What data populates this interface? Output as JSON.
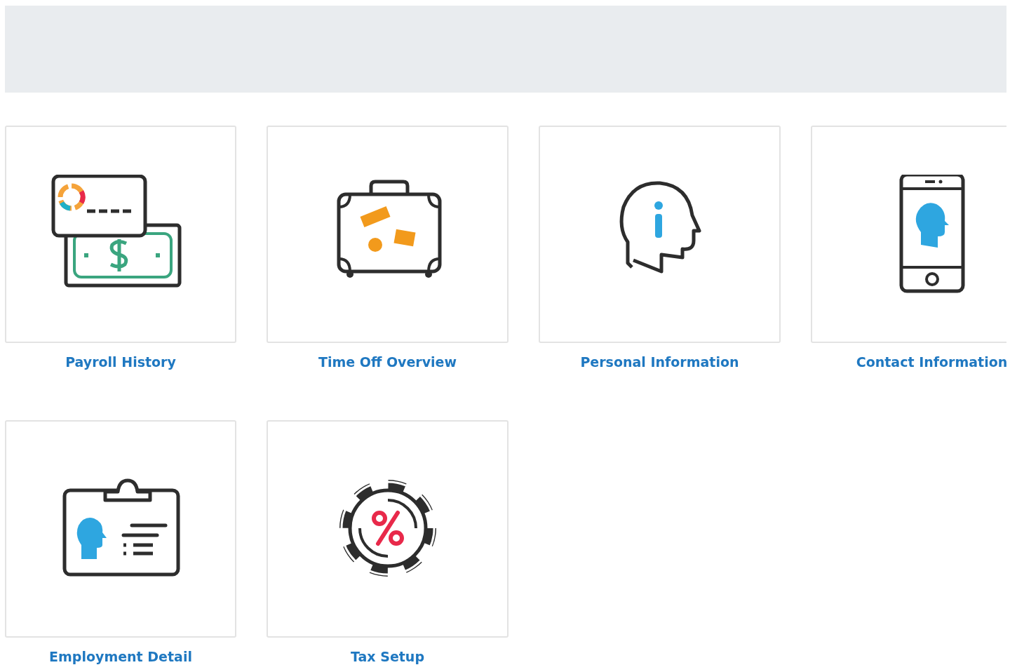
{
  "tiles": [
    {
      "label": "Payroll History"
    },
    {
      "label": "Time Off Overview"
    },
    {
      "label": "Personal Information"
    },
    {
      "label": "Contact Information"
    },
    {
      "label": "Employment Detail"
    },
    {
      "label": "Tax Setup"
    }
  ]
}
